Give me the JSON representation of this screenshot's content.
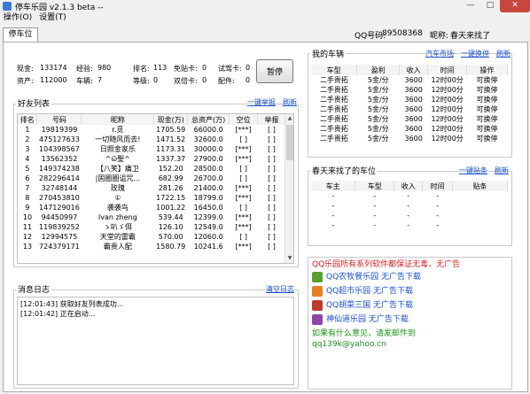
{
  "window": {
    "title": "停车乐园 v2.1.3 beta --",
    "minimize": "—",
    "maximize": "□",
    "close": "✕"
  },
  "menu": [
    "操作(O)",
    "设置(T)"
  ],
  "tab": "停车位",
  "header": {
    "qq_label": "QQ号码:",
    "qq_value": "89508368",
    "nick_label": "昵称:",
    "nick_value": "春天来找了"
  },
  "info": {
    "cash_label": "现金:",
    "cash": "133174",
    "exp_label": "经验:",
    "exp": "980",
    "rank_label": "排名:",
    "rank": "113",
    "free_card_label": "免贴卡:",
    "free_card": "0",
    "trial_card_label": "试驾卡:",
    "trial_card": "0",
    "assets_label": "资产:",
    "assets": "112000",
    "cars_label": "车辆:",
    "cars": "7",
    "level_label": "等级:",
    "level": "0",
    "double_card_label": "双倍卡:",
    "double_card": "0",
    "parts_label": "配件:",
    "parts": "0",
    "pause_button": "暂停"
  },
  "friends": {
    "title": "好友列表",
    "link1": "一键举报",
    "link2": "刷新",
    "columns": [
      "排名",
      "号码",
      "昵称",
      "现金(万)",
      "总资产(万)",
      "空位",
      "举报"
    ],
    "rows": [
      [
        "1",
        "19819399",
        "r.觅",
        "1705.59",
        "66000.0",
        "[***]",
        "[ ]"
      ],
      [
        "2",
        "475127633",
        "一切随风而去!",
        "1471.52",
        "32600.0",
        "[ ]",
        "[ ]"
      ],
      [
        "3",
        "104398567",
        "日照金家乐",
        "1173.31",
        "30000.0",
        "[***]",
        "[ ]"
      ],
      [
        "4",
        "13562352",
        "^ω̃聖^",
        "1337.37",
        "27900.0",
        "[***]",
        "[ ]"
      ],
      [
        "5",
        "149374238",
        "【八笑】痛卫",
        "152.20",
        "28500.0",
        "[ ]",
        "[ ]"
      ],
      [
        "6",
        "282296414",
        "|固圈圈诅咒...",
        "682.99",
        "26700.0",
        "[ ]",
        "[ ]"
      ],
      [
        "7",
        "32748144",
        "玫瑰",
        "281.26",
        "21400.0",
        "[***]",
        "[ ]"
      ],
      [
        "8",
        "270453810",
        "①",
        "1722.15",
        "18799.0",
        "[***]",
        "[ ]"
      ],
      [
        "9",
        "147129016",
        "袭袭鸟",
        "1001.22",
        "16450.0",
        "[ ]",
        "[ ]"
      ],
      [
        "10",
        "94450997",
        "Ivan zheng",
        "539.44",
        "12399.0",
        "[***]",
        "[ ]"
      ],
      [
        "11",
        "119839252",
        "ゝ叭ゞ佴",
        "126.10",
        "12549.0",
        "[***]",
        "[ ]"
      ],
      [
        "12",
        "12994575",
        "天堂的雷霸",
        "570.00",
        "12060.0",
        "[ ]",
        "[ ]"
      ],
      [
        "13",
        "724379171",
        "霸贵人配",
        "1580.79",
        "10241.6",
        "[***]",
        "[ ]"
      ]
    ]
  },
  "my_cars": {
    "title": "我的车辆",
    "link1": "汽车市场",
    "link2": "一键换停",
    "link3": "刷新",
    "columns": [
      "车型",
      "盈利",
      "收入",
      "时间",
      "操作"
    ],
    "rows": [
      [
        "二手贵拓",
        "5金/分",
        "3600",
        "12时00分",
        "可换停"
      ],
      [
        "二手贵拓",
        "5金/分",
        "3600",
        "12时00分",
        "可换停"
      ],
      [
        "二手贵拓",
        "5金/分",
        "3600",
        "12时00分",
        "可换停"
      ],
      [
        "二手贵拓",
        "5金/分",
        "3600",
        "12时00分",
        "可换停"
      ],
      [
        "二手贵拓",
        "5金/分",
        "3600",
        "12时00分",
        "可换停"
      ],
      [
        "二手贵拓",
        "5金/分",
        "3600",
        "12时00分",
        "可换停"
      ],
      [
        "二手贵拓",
        "5金/分",
        "3600",
        "12时00分",
        "可换停"
      ]
    ]
  },
  "spots": {
    "title": "春天来找了的车位",
    "link1": "一键贴条",
    "link2": "刷新",
    "columns": [
      "车主",
      "车型",
      "收入",
      "时间",
      "贴条"
    ],
    "rows": [
      [
        "-",
        "-",
        "-",
        "-",
        ""
      ],
      [
        "-",
        "-",
        "-",
        "-",
        ""
      ],
      [
        "-",
        "-",
        "-",
        "-",
        ""
      ],
      [
        "-",
        "-",
        "-",
        "-",
        ""
      ]
    ]
  },
  "log": {
    "title": "消息日志",
    "clear_link": "清空日志",
    "lines": [
      "[12:01:43] 获取好友列表成功...",
      "[12:01:42] 正在启动..."
    ]
  },
  "ad": {
    "headline": "QQ乐园所有系列软件都保证无毒，无广告",
    "items": [
      {
        "label": "QQ农牧餐乐园  无广告下载",
        "icon": "pasture-icon",
        "color": "#5aa02c"
      },
      {
        "label": "QQ超市乐园  无广告下载",
        "icon": "supermarket-icon",
        "color": "#e67e22"
      },
      {
        "label": "QQ胡菜三国  无广告下载",
        "icon": "three-kingdoms-icon",
        "color": "#c0392b"
      },
      {
        "label": "神仙道乐园  无广告下载",
        "icon": "immortal-icon",
        "color": "#8e44ad"
      }
    ],
    "feedback": "如果有什么意见，请发邮件到",
    "email": "qq139k@yahoo.cn"
  }
}
